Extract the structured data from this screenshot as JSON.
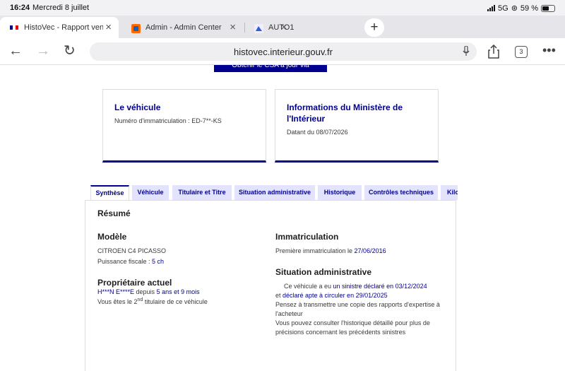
{
  "status": {
    "time": "16:24",
    "date": "Mercredi 8 juillet",
    "network": "5G",
    "battery": "59 %"
  },
  "tabs": [
    {
      "label": "HistoVec - Rapport vendeur",
      "active": true
    },
    {
      "label": "Admin - Admin Center",
      "active": false
    },
    {
      "label": "AUTO1",
      "active": false
    }
  ],
  "toolbar": {
    "url": "histovec.interieur.gouv.fr",
    "tab_count": "3"
  },
  "page": {
    "top_button": "Obtenir le CSA à jour via FranceConnect",
    "vehicle_card": {
      "title": "Le véhicule",
      "line": "Numéro d'immatriculation : ED-7**-KS"
    },
    "ministry_card": {
      "title": "Informations du Ministère de l'Intérieur",
      "line": "Datant du 08/07/2026"
    },
    "content_tabs": [
      "Synthèse",
      "Véhicule",
      "Titulaire et Titre",
      "Situation administrative",
      "Historique",
      "Contrôles techniques",
      "Kilométrage"
    ],
    "resume": "Résumé",
    "modele": {
      "heading": "Modèle",
      "name": "CITROEN C4 PICASSO",
      "puissance_label": "Puissance fiscale : ",
      "puissance_value": "5 ch"
    },
    "proprietaire": {
      "heading": "Propriétaire actuel",
      "name": "H***N E****E",
      "depuis_label": " depuis ",
      "depuis_value": "5 ans et 9 mois",
      "titulaire_pre": "Vous êtes le 2",
      "titulaire_sup": "nd",
      "titulaire_post": " titulaire de ce véhicule"
    },
    "immatriculation": {
      "heading": "Immatriculation",
      "label": "Première immatriculation le ",
      "date": "27/06/2016"
    },
    "situation": {
      "heading": "Situation administrative",
      "l1_pre": "Ce véhicule a eu ",
      "l1_link": "un sinistre déclaré en 03/12/2024",
      "l2_pre": "et ",
      "l2_link": "déclaré apte à circuler en 29/01/2025",
      "l3a": "Pensez à transmettre une copie des rapports d'expertise à",
      "l3b": "l'acheteur",
      "l4a": "Vous pouvez consulter l'historique détaillé pour plus de",
      "l4b": "précisions concernant les précédents sinistres"
    }
  }
}
